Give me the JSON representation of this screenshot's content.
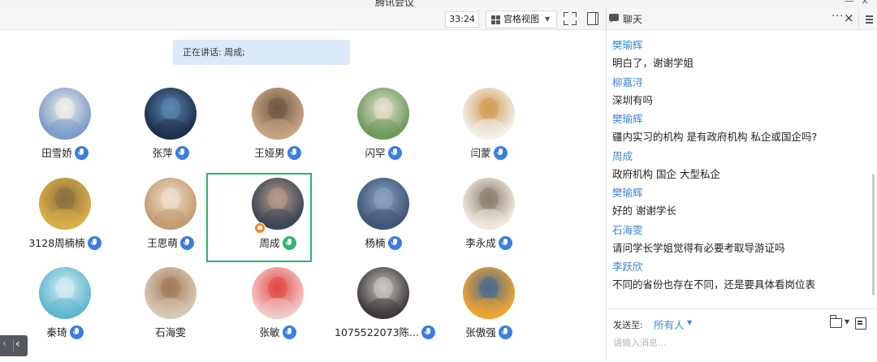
{
  "window": {
    "title": "腾讯会议"
  },
  "toolbar": {
    "timer": "33:24",
    "view_mode": "宫格视图"
  },
  "speaking": {
    "label": "正在讲话: 周成;"
  },
  "participants": [
    {
      "name": "田雪娇",
      "mic": "on",
      "colors": [
        "#7a9cc8",
        "#f4f0ea"
      ]
    },
    {
      "name": "张萍",
      "mic": "on",
      "colors": [
        "#1e2f4d",
        "#5b89b1"
      ]
    },
    {
      "name": "王娅男",
      "mic": "on",
      "colors": [
        "#c7a583",
        "#6f5843"
      ]
    },
    {
      "name": "闪罕",
      "mic": "on",
      "colors": [
        "#6d9a5c",
        "#e7e1cf"
      ]
    },
    {
      "name": "闫蒙",
      "mic": "on",
      "colors": [
        "#f1efe8",
        "#d39a55"
      ]
    },
    {
      "name": "3128周楠楠",
      "mic": "on",
      "colors": [
        "#d8b047",
        "#8a6d3f"
      ]
    },
    {
      "name": "王思萌",
      "mic": "on",
      "colors": [
        "#c49a6e",
        "#efe2cf"
      ]
    },
    {
      "name": "周成",
      "mic": "speaking",
      "colors": [
        "#3c4555",
        "#b89c8c"
      ]
    },
    {
      "name": "杨楠",
      "mic": "on",
      "colors": [
        "#3e5578",
        "#8ea3c2"
      ]
    },
    {
      "name": "李永成",
      "mic": "on",
      "colors": [
        "#efe9de",
        "#8a7d6c"
      ]
    },
    {
      "name": "秦琦",
      "mic": "on",
      "colors": [
        "#5fb7cf",
        "#d7eef2"
      ]
    },
    {
      "name": "石海雯",
      "mic": "none",
      "colors": [
        "#d8c8b4",
        "#a57b58"
      ]
    },
    {
      "name": "张敏",
      "mic": "on",
      "colors": [
        "#f3c8c8",
        "#e24b44"
      ]
    },
    {
      "name": "1075522073陈...",
      "mic": "on",
      "colors": [
        "#3d3a3a",
        "#cfc8c2"
      ]
    },
    {
      "name": "张傲强",
      "mic": "on",
      "colors": [
        "#f0a534",
        "#4a6a8e"
      ]
    }
  ],
  "chat": {
    "title": "聊天",
    "messages": [
      {
        "sender": "樊瑜辉",
        "text": "明白了，谢谢学姐"
      },
      {
        "sender": "柳嘉浔",
        "text": "深圳有吗"
      },
      {
        "sender": "樊瑜辉",
        "text": "疆内实习的机构 是有政府机构 私企或国企吗?"
      },
      {
        "sender": "周成",
        "text": "政府机构  国企  大型私企"
      },
      {
        "sender": "樊瑜辉",
        "text": "好的 谢谢学长"
      },
      {
        "sender": "石海雯",
        "text": "请问学长学姐觉得有必要考取导游证吗"
      },
      {
        "sender": "李跃欣",
        "text": "不同的省份也存在不同，还是要具体看岗位表"
      }
    ],
    "send_label": "发送至:",
    "send_target": "所有人",
    "input_placeholder": "请输入消息..."
  }
}
